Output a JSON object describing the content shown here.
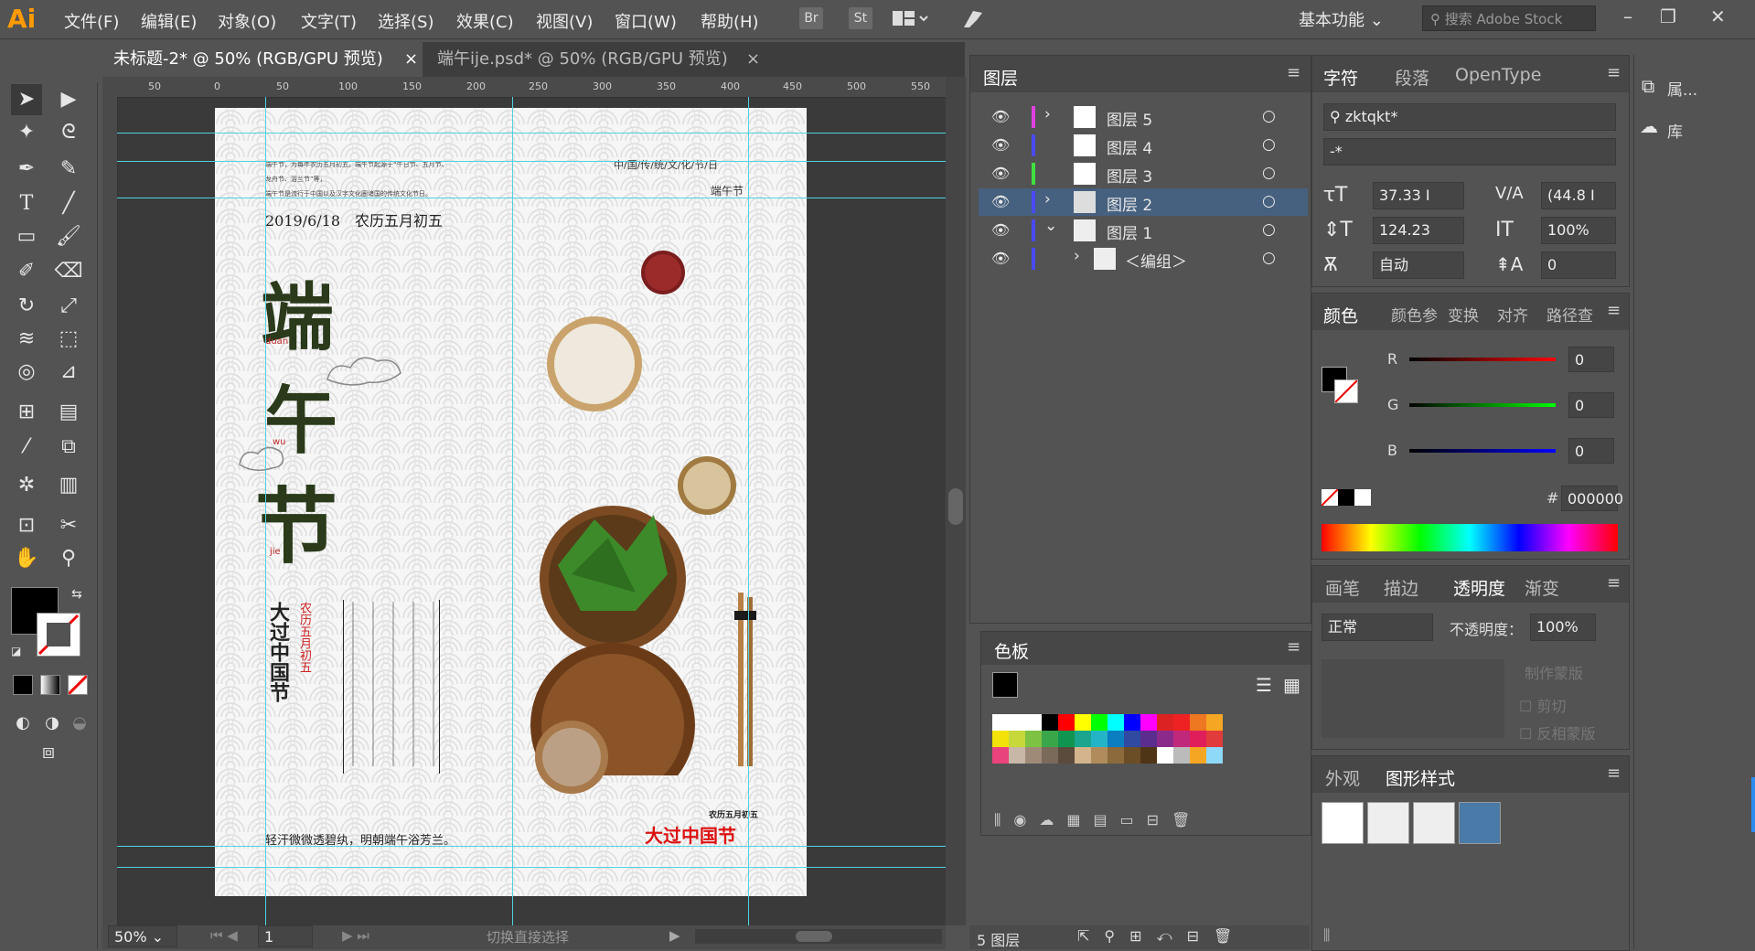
{
  "app": {
    "logo": "Ai"
  },
  "menu": [
    "文件(F)",
    "编辑(E)",
    "对象(O)",
    "文字(T)",
    "选择(S)",
    "效果(C)",
    "视图(V)",
    "窗口(W)",
    "帮助(H)"
  ],
  "menu_icons": [
    "Br",
    "St"
  ],
  "workspace": "基本功能",
  "search_placeholder": "搜索 Adobe Stock",
  "tabs": [
    {
      "label": "未标题-2* @ 50% (RGB/GPU 预览)"
    },
    {
      "label": "端午ije.psd* @ 50% (RGB/GPU 预览)"
    }
  ],
  "tab_close": "×",
  "ruler_top": [
    "50",
    "0",
    "50",
    "100",
    "150",
    "200",
    "250",
    "300",
    "350",
    "400",
    "450",
    "500",
    "550"
  ],
  "poster": {
    "top_small_lines": [
      "端午节，为每年农历五月初五。端午节起源于“午日节、五月节、",
      "龙舟节、浴兰节”等，",
      "端午节是流行于中国以及汉字文化圈诸国的传统文化节日。"
    ],
    "top_right": "中/国/传/统/文/化/节/日",
    "top_right2": "端午节",
    "date": "2019/6/18　农历五月初五",
    "big_chars": [
      "端",
      "午",
      "节"
    ],
    "pinyin": [
      "duan",
      "wu",
      "jie"
    ],
    "vertical_title": "大过中国节",
    "vertical_red": "农历五月初五",
    "bottom_left": "轻汗微微透碧纨，明朝端午浴芳兰。",
    "bottom_right_small": "农历五月初五",
    "bottom_right": "大过中国节"
  },
  "status": {
    "zoom": "50%",
    "page": "1",
    "mode": "切换直接选择"
  },
  "layers_panel": {
    "title": "图层",
    "rows": [
      {
        "name": "图层 5",
        "color": "#e040e0",
        "selected": false,
        "expand": "›"
      },
      {
        "name": "图层 4",
        "color": "#4a4aff",
        "selected": false,
        "expand": ""
      },
      {
        "name": "图层 3",
        "color": "#40e040",
        "selected": false,
        "expand": ""
      },
      {
        "name": "图层 2",
        "color": "#4a4aff",
        "selected": true,
        "expand": "›"
      },
      {
        "name": "图层 1",
        "color": "#4a4aff",
        "selected": false,
        "expand": "⌄"
      },
      {
        "name": "＜编组＞",
        "color": "#4a4aff",
        "selected": false,
        "expand": "›"
      }
    ],
    "footer": "5 图层"
  },
  "swatches_panel": {
    "title": "色板",
    "rows": [
      [
        "#ffffff",
        "#ffffff",
        "#ffffff",
        "#000000",
        "#ff0000",
        "#ffff00",
        "#00ff00",
        "#00ffff",
        "#0000ff",
        "#ff00ff",
        "#dd2222",
        "#ee2222",
        "#ee7722",
        "#f5a623"
      ],
      [
        "#f2e20a",
        "#c6d83a",
        "#7dc242",
        "#3aa64a",
        "#109550",
        "#1aa58f",
        "#23b5c7",
        "#0b7dc1",
        "#2f4aa0",
        "#5a2d8f",
        "#8c2a8c",
        "#c0287b",
        "#e01e5a",
        "#e23b3b"
      ],
      [
        "#e8437d",
        "#c8b7a6",
        "#9f8a78",
        "#7a6a5a",
        "#5b4b3c",
        "#d3b48c",
        "#b08c5c",
        "#8c6a3c",
        "#6b4d26",
        "#4d3515",
        "#ffffff",
        "#bbbbbb",
        "#f5a623",
        "#8ed8f8"
      ]
    ]
  },
  "character_panel": {
    "tabs": [
      "字符",
      "段落",
      "OpenType"
    ],
    "font_family": "zktqkt*",
    "font_style": "-*",
    "font_size": "37.33 I",
    "kerning": "(44.8 I",
    "leading": "124.23",
    "scale_v": "100%",
    "tracking": "自动",
    "baseline": "0"
  },
  "color_panel": {
    "tabs": [
      "颜色",
      "颜色参",
      "变换",
      "对齐",
      "路径查"
    ],
    "r": "0",
    "g": "0",
    "b": "0",
    "hex_label": "#",
    "hex": "000000"
  },
  "transparency_panel": {
    "tabs": [
      "画笔",
      "描边",
      "透明度",
      "渐变"
    ],
    "blend": "正常",
    "opacity_label": "不透明度：",
    "opacity": "100%",
    "make_mask": "制作蒙版",
    "clip": "剪切",
    "invert": "反相蒙版"
  },
  "appearance_panel": {
    "tabs": [
      "外观",
      "图形样式"
    ]
  },
  "side_panel": {
    "properties": "属...",
    "libraries": "库"
  }
}
